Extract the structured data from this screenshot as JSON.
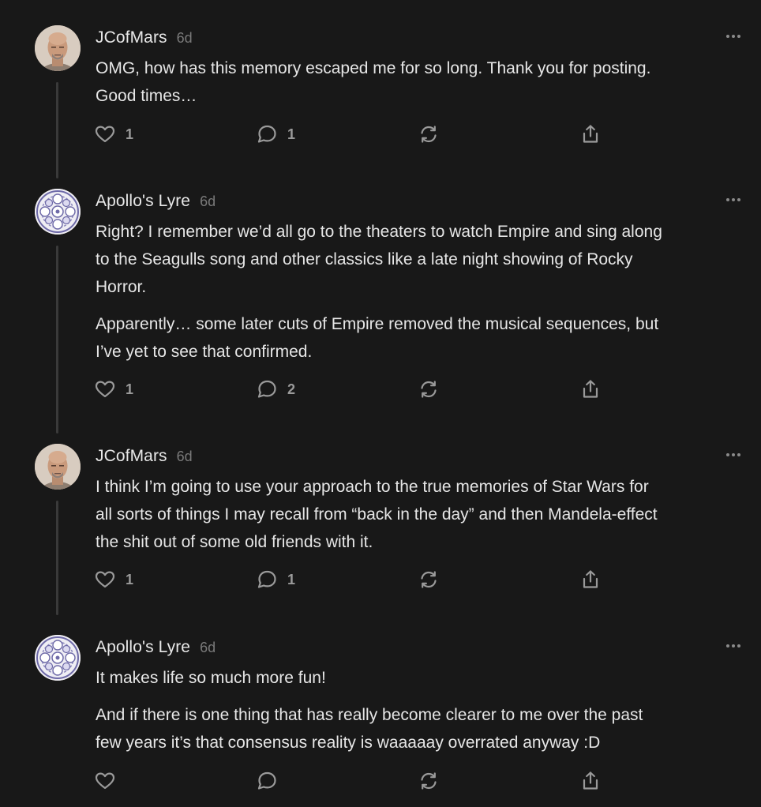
{
  "comments": [
    {
      "author": "JCofMars",
      "age": "6d",
      "avatar": "bald-man-avatar",
      "paragraphs": [
        "OMG, how has this memory escaped me for so long. Thank you for posting.\nGood times…"
      ],
      "likes": "1",
      "replies": "1"
    },
    {
      "author": "Apollo's Lyre",
      "age": "6d",
      "avatar": "mandala-avatar",
      "paragraphs": [
        "Right? I remember we’d all go to the theaters to watch Empire and sing along\nto the Seagulls song and other classics like a late night showing of Rocky\nHorror.",
        "Apparently… some later cuts of Empire removed the musical sequences, but\nI’ve yet to see that confirmed."
      ],
      "likes": "1",
      "replies": "2"
    },
    {
      "author": "JCofMars",
      "age": "6d",
      "avatar": "bald-man-avatar",
      "paragraphs": [
        "I think I’m going to use your approach to the true memories of Star Wars for\nall sorts of things I may recall from “back in the day” and then Mandela-effect\nthe shit out of some old friends with it."
      ],
      "likes": "1",
      "replies": "1"
    },
    {
      "author": "Apollo's Lyre",
      "age": "6d",
      "avatar": "mandala-avatar",
      "paragraphs": [
        "It makes life so much more fun!",
        "And if there is one thing that has really become clearer to me over the past\nfew years it’s that consensus reality is waaaaay overrated anyway :D"
      ],
      "likes": "",
      "replies": ""
    }
  ],
  "icons": {
    "like": "heart-icon",
    "reply": "speech-bubble-icon",
    "restack": "restack-icon",
    "share": "share-icon",
    "more": "ellipsis-icon"
  },
  "colors": {
    "background": "#181818",
    "text": "#e6e6e6",
    "muted": "#7a7a7a",
    "icon": "#9a9a9a"
  }
}
